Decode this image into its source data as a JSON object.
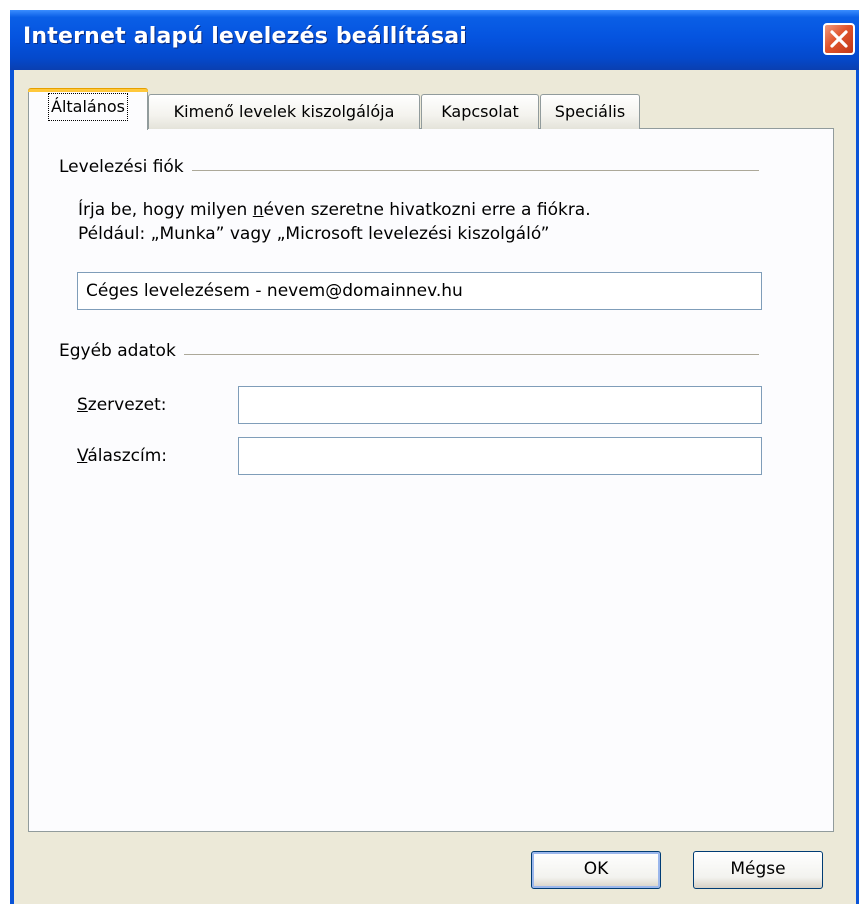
{
  "window": {
    "title": "Internet alapú levelezés beállításai",
    "close_icon": "close-x-icon",
    "accent_colors": {
      "titlebar": "#0554e0",
      "close_button": "#e0542c",
      "active_tab_highlight": "#ffc83c"
    }
  },
  "tabs": [
    {
      "label": "Általános",
      "active": true
    },
    {
      "label": "Kimenő levelek kiszolgálója",
      "active": false
    },
    {
      "label": "Kapcsolat",
      "active": false
    },
    {
      "label": "Speciális",
      "active": false
    }
  ],
  "account_group": {
    "label": "Levelezési fiók",
    "description_line1_prefix": "Írja be, hogy milyen ",
    "description_line1_hotkey": "n",
    "description_line1_suffix": "éven szeretne hivatkozni erre a fiókra.",
    "description_line2": "Például: „Munka” vagy „Microsoft levelezési kiszolgáló”",
    "account_name_value": "Céges levelezésem - nevem@domainnev.hu"
  },
  "other_group": {
    "label": "Egyéb adatok",
    "organization": {
      "hotkey": "S",
      "label_rest": "zervezet:",
      "value": ""
    },
    "reply_address": {
      "hotkey": "V",
      "label_rest": "álaszcím:",
      "value": ""
    }
  },
  "buttons": {
    "ok": "OK",
    "cancel": "Mégse"
  }
}
